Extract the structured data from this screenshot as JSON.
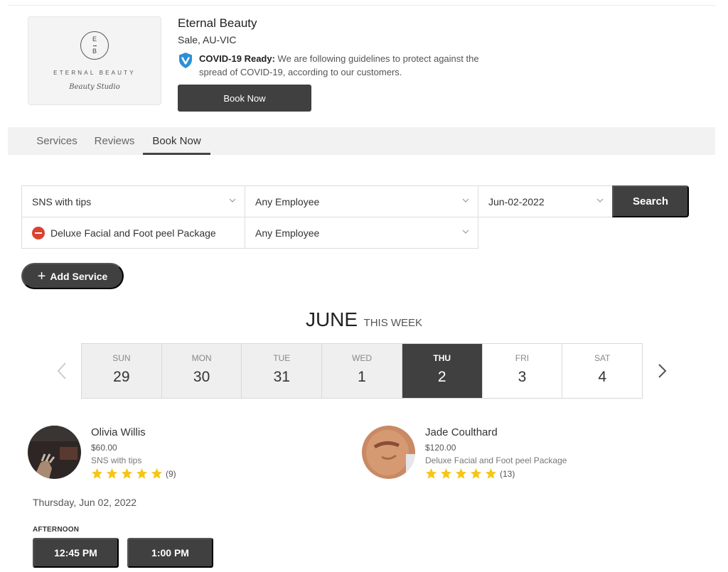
{
  "business": {
    "logo": {
      "monogram_top": "E",
      "monogram_bottom": "B",
      "name": "ETERNAL BEAUTY",
      "script": "Beauty Studio"
    },
    "name": "Eternal Beauty",
    "location": "Sale, AU-VIC",
    "covid": {
      "icon": "shield-check-icon",
      "label": "COVID-19 Ready:",
      "text": " We are following guidelines to protect against the spread of COVID-19, according to our customers."
    },
    "book_now_label": "Book Now"
  },
  "tabs": [
    {
      "label": "Services",
      "active": false
    },
    {
      "label": "Reviews",
      "active": false
    },
    {
      "label": "Book Now",
      "active": true
    }
  ],
  "booking": {
    "rows": [
      {
        "service": "SNS with tips",
        "employee": "Any Employee",
        "removable": false
      },
      {
        "service": "Deluxe Facial and Foot peel Package",
        "employee": "Any Employee",
        "removable": true
      }
    ],
    "date": "Jun-02-2022",
    "search_label": "Search",
    "add_service_label": "Add Service"
  },
  "calendar": {
    "month": "JUNE",
    "subtitle": "THIS WEEK",
    "days": [
      {
        "name": "SUN",
        "num": "29",
        "state": "past"
      },
      {
        "name": "MON",
        "num": "30",
        "state": "past"
      },
      {
        "name": "TUE",
        "num": "31",
        "state": "past"
      },
      {
        "name": "WED",
        "num": "1",
        "state": "past"
      },
      {
        "name": "THU",
        "num": "2",
        "state": "selected"
      },
      {
        "name": "FRI",
        "num": "3",
        "state": "future"
      },
      {
        "name": "SAT",
        "num": "4",
        "state": "future"
      }
    ]
  },
  "staff": [
    {
      "name": "Olivia Willis",
      "price": "$60.00",
      "service": "SNS with tips",
      "rating": 5,
      "reviews": "(9)"
    },
    {
      "name": "Jade Coulthard",
      "price": "$120.00",
      "service": "Deluxe Facial and Foot peel Package",
      "rating": 5,
      "reviews": "(13)"
    }
  ],
  "availability": {
    "date_label": "Thursday, Jun 02, 2022",
    "period": "AFTERNOON",
    "slots": [
      "12:45 PM",
      "1:00 PM"
    ]
  },
  "colors": {
    "dark": "#404040",
    "star": "#f5c518",
    "remove": "#d9432f",
    "shield": "#2b8fd6"
  }
}
